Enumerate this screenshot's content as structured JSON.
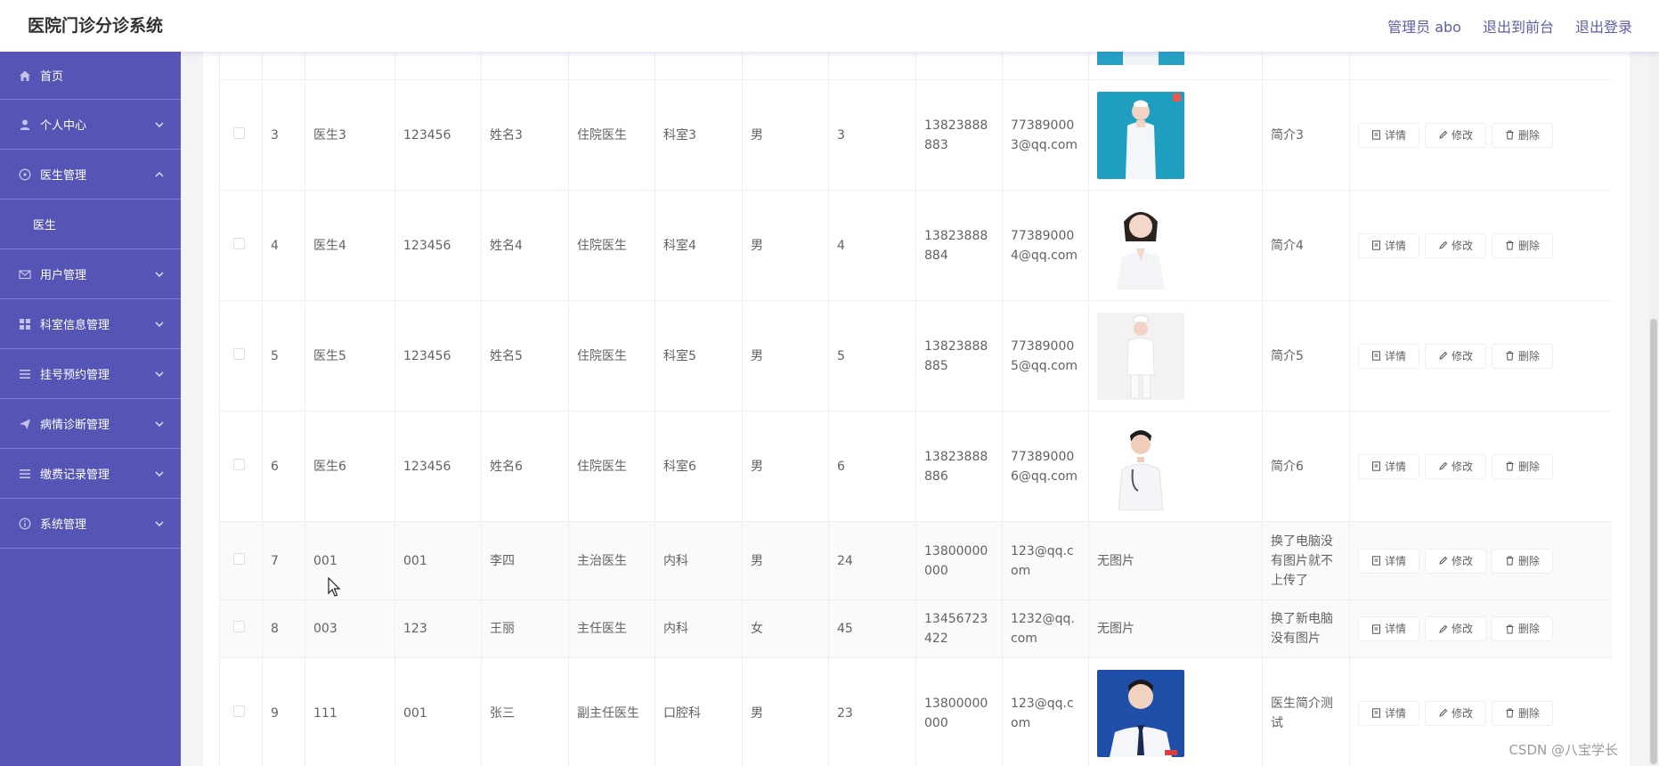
{
  "header": {
    "title": "医院门诊分诊系统",
    "admin_label": "管理员 abo",
    "back_to_front": "退出到前台",
    "logout": "退出登录"
  },
  "sidebar": {
    "items": [
      {
        "label": "首页",
        "icon": "home-icon"
      },
      {
        "label": "个人中心",
        "icon": "user-icon"
      },
      {
        "label": "医生管理",
        "icon": "compass-icon",
        "expanded": true
      },
      {
        "label": "医生",
        "icon": null
      },
      {
        "label": "用户管理",
        "icon": "mail-icon"
      },
      {
        "label": "科室信息管理",
        "icon": "grid-icon"
      },
      {
        "label": "挂号预约管理",
        "icon": "list-icon"
      },
      {
        "label": "病情诊断管理",
        "icon": "send-icon"
      },
      {
        "label": "缴费记录管理",
        "icon": "list-icon"
      },
      {
        "label": "系统管理",
        "icon": "info-icon"
      }
    ]
  },
  "actions": {
    "detail": "详情",
    "edit": "修改",
    "delete": "删除"
  },
  "table": {
    "rows": [
      {
        "no": "3",
        "account": "医生3",
        "password": "123456",
        "name": "姓名3",
        "title": "住院医生",
        "dept": "科室3",
        "gender": "男",
        "age": "3",
        "phone": "13823888883",
        "email": "773890003@qq.com",
        "photo": "nurse-photo-teal",
        "intro": "简介3"
      },
      {
        "no": "4",
        "account": "医生4",
        "password": "123456",
        "name": "姓名4",
        "title": "住院医生",
        "dept": "科室4",
        "gender": "男",
        "age": "4",
        "phone": "13823888884",
        "email": "773890004@qq.com",
        "photo": "doctor-photo-female",
        "intro": "简介4"
      },
      {
        "no": "5",
        "account": "医生5",
        "password": "123456",
        "name": "姓名5",
        "title": "住院医生",
        "dept": "科室5",
        "gender": "男",
        "age": "5",
        "phone": "13823888885",
        "email": "773890005@qq.com",
        "photo": "nurse-photo-white",
        "intro": "简介5"
      },
      {
        "no": "6",
        "account": "医生6",
        "password": "123456",
        "name": "姓名6",
        "title": "住院医生",
        "dept": "科室6",
        "gender": "男",
        "age": "6",
        "phone": "13823888886",
        "email": "773890006@qq.com",
        "photo": "doctor-photo-male",
        "intro": "简介6"
      },
      {
        "no": "7",
        "account": "001",
        "password": "001",
        "name": "李四",
        "title": "主治医生",
        "dept": "内科",
        "gender": "男",
        "age": "24",
        "phone": "13800000000",
        "email": "123@qq.com",
        "photo_text": "无图片",
        "intro": "换了电脑没有图片就不上传了"
      },
      {
        "no": "8",
        "account": "003",
        "password": "123",
        "name": "王丽",
        "title": "主任医生",
        "dept": "内科",
        "gender": "女",
        "age": "45",
        "phone": "13456723422",
        "email": "1232@qq.com",
        "photo_text": "无图片",
        "intro": "换了新电脑没有图片"
      },
      {
        "no": "9",
        "account": "111",
        "password": "001",
        "name": "张三",
        "title": "副主任医生",
        "dept": "口腔科",
        "gender": "男",
        "age": "23",
        "phone": "13800000000",
        "email": "123@qq.com",
        "photo": "doctor-photo-suit",
        "intro": "医生简介测试"
      }
    ]
  },
  "watermark": "CSDN @八宝学长"
}
